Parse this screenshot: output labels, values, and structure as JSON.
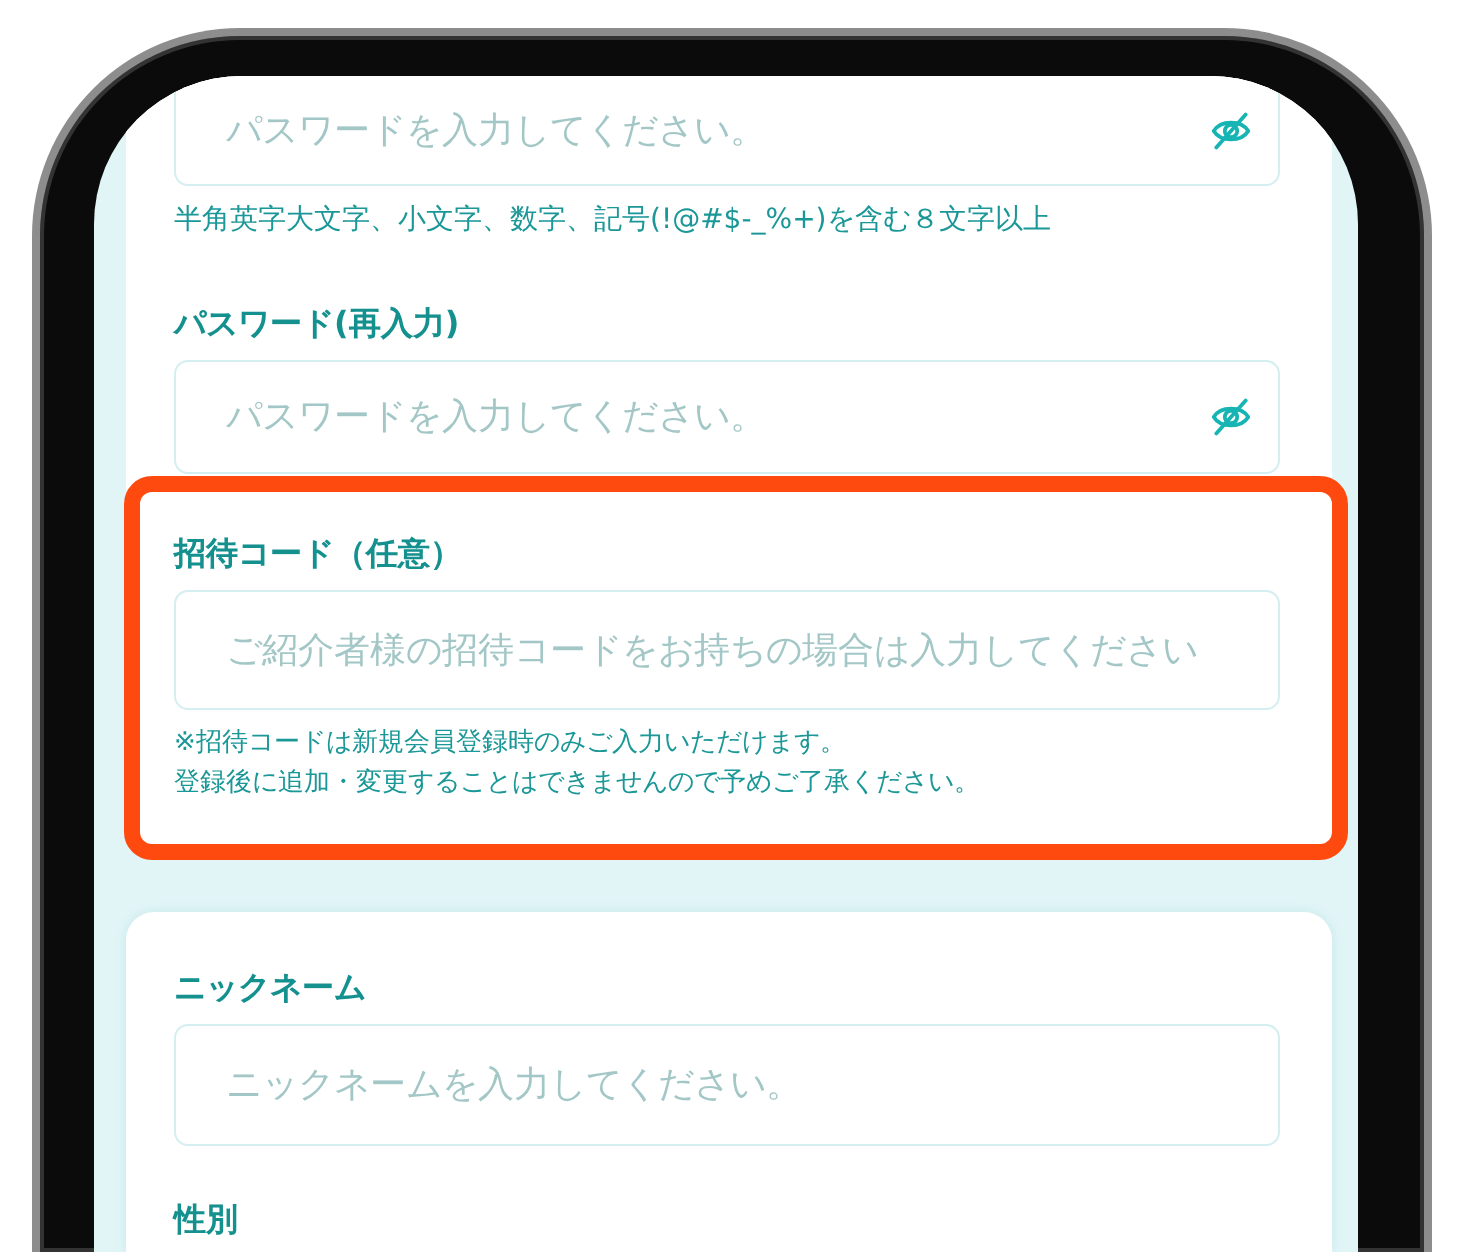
{
  "account_card": {
    "password": {
      "placeholder": "パスワードを入力してください。",
      "visible": false
    },
    "password_hint": "半角英字大文字、小文字、数字、記号(!@#$-_%+)を含む８文字以上",
    "password_confirm": {
      "label": "パスワード(再入力)",
      "placeholder": "パスワードを入力してください。",
      "visible": false
    },
    "invite_code": {
      "label": "招待コード（任意）",
      "placeholder": "ご紹介者様の招待コードをお持ちの場合は入力してください",
      "highlighted": true,
      "notes": [
        "※招待コードは新規会員登録時のみご入力いただけます。",
        "登録後に追加・変更することはできませんので予めご了承ください。"
      ]
    }
  },
  "profile_card": {
    "nickname": {
      "label": "ニックネーム",
      "placeholder": "ニックネームを入力してください。"
    },
    "gender": {
      "label": "性別"
    }
  }
}
